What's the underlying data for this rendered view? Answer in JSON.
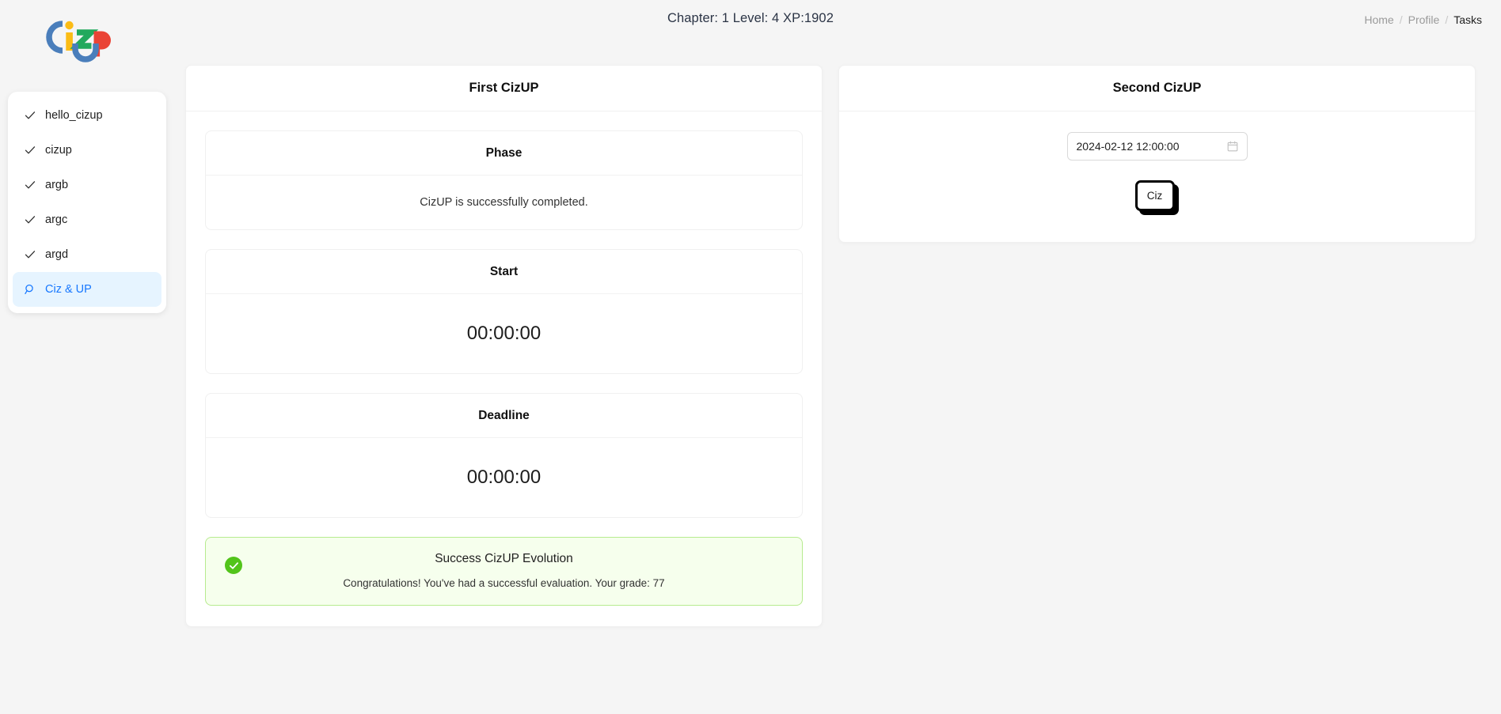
{
  "header": {
    "title": "Chapter: 1 Level: 4 XP:1902",
    "logo_alt": "CizUP"
  },
  "breadcrumb": {
    "items": [
      {
        "label": "Home",
        "current": false
      },
      {
        "label": "Profile",
        "current": false
      },
      {
        "label": "Tasks",
        "current": true
      }
    ],
    "separator": "/"
  },
  "sidebar": {
    "items": [
      {
        "label": "hello_cizup",
        "icon": "check-icon",
        "selected": false
      },
      {
        "label": "cizup",
        "icon": "check-icon",
        "selected": false
      },
      {
        "label": "argb",
        "icon": "check-icon",
        "selected": false
      },
      {
        "label": "argc",
        "icon": "check-icon",
        "selected": false
      },
      {
        "label": "argd",
        "icon": "check-icon",
        "selected": false
      },
      {
        "label": "Ciz & UP",
        "icon": "search-icon",
        "selected": true
      }
    ]
  },
  "left_panel": {
    "title": "First CizUP",
    "phase": {
      "title": "Phase",
      "value": "CizUP is successfully completed."
    },
    "start": {
      "title": "Start",
      "value": "00:00:00"
    },
    "deadline": {
      "title": "Deadline",
      "value": "00:00:00"
    },
    "alert": {
      "icon": "check-circle-icon",
      "title": "Success CizUP Evolution",
      "description": "Congratulations! You've had a successful evaluation. Your grade: 77",
      "grade": 77,
      "bg_color": "#f6ffed",
      "border_color": "#b7eb8f",
      "icon_color": "#52c41a"
    }
  },
  "right_panel": {
    "title": "Second CizUP",
    "date_input": {
      "value": "2024-02-12 12:00:00",
      "placeholder": "Select date",
      "icon": "calendar-icon"
    },
    "submit_button": {
      "label": "Ciz"
    }
  },
  "colors": {
    "page_background": "#f5f5f5",
    "accent_blue": "#1677ff",
    "selected_bg": "#e6f4ff",
    "success_green": "#52c41a",
    "logo_blue": "#4a7ebb",
    "logo_yellow": "#fbbc15",
    "logo_green": "#22a95d",
    "logo_red": "#ea4335"
  }
}
